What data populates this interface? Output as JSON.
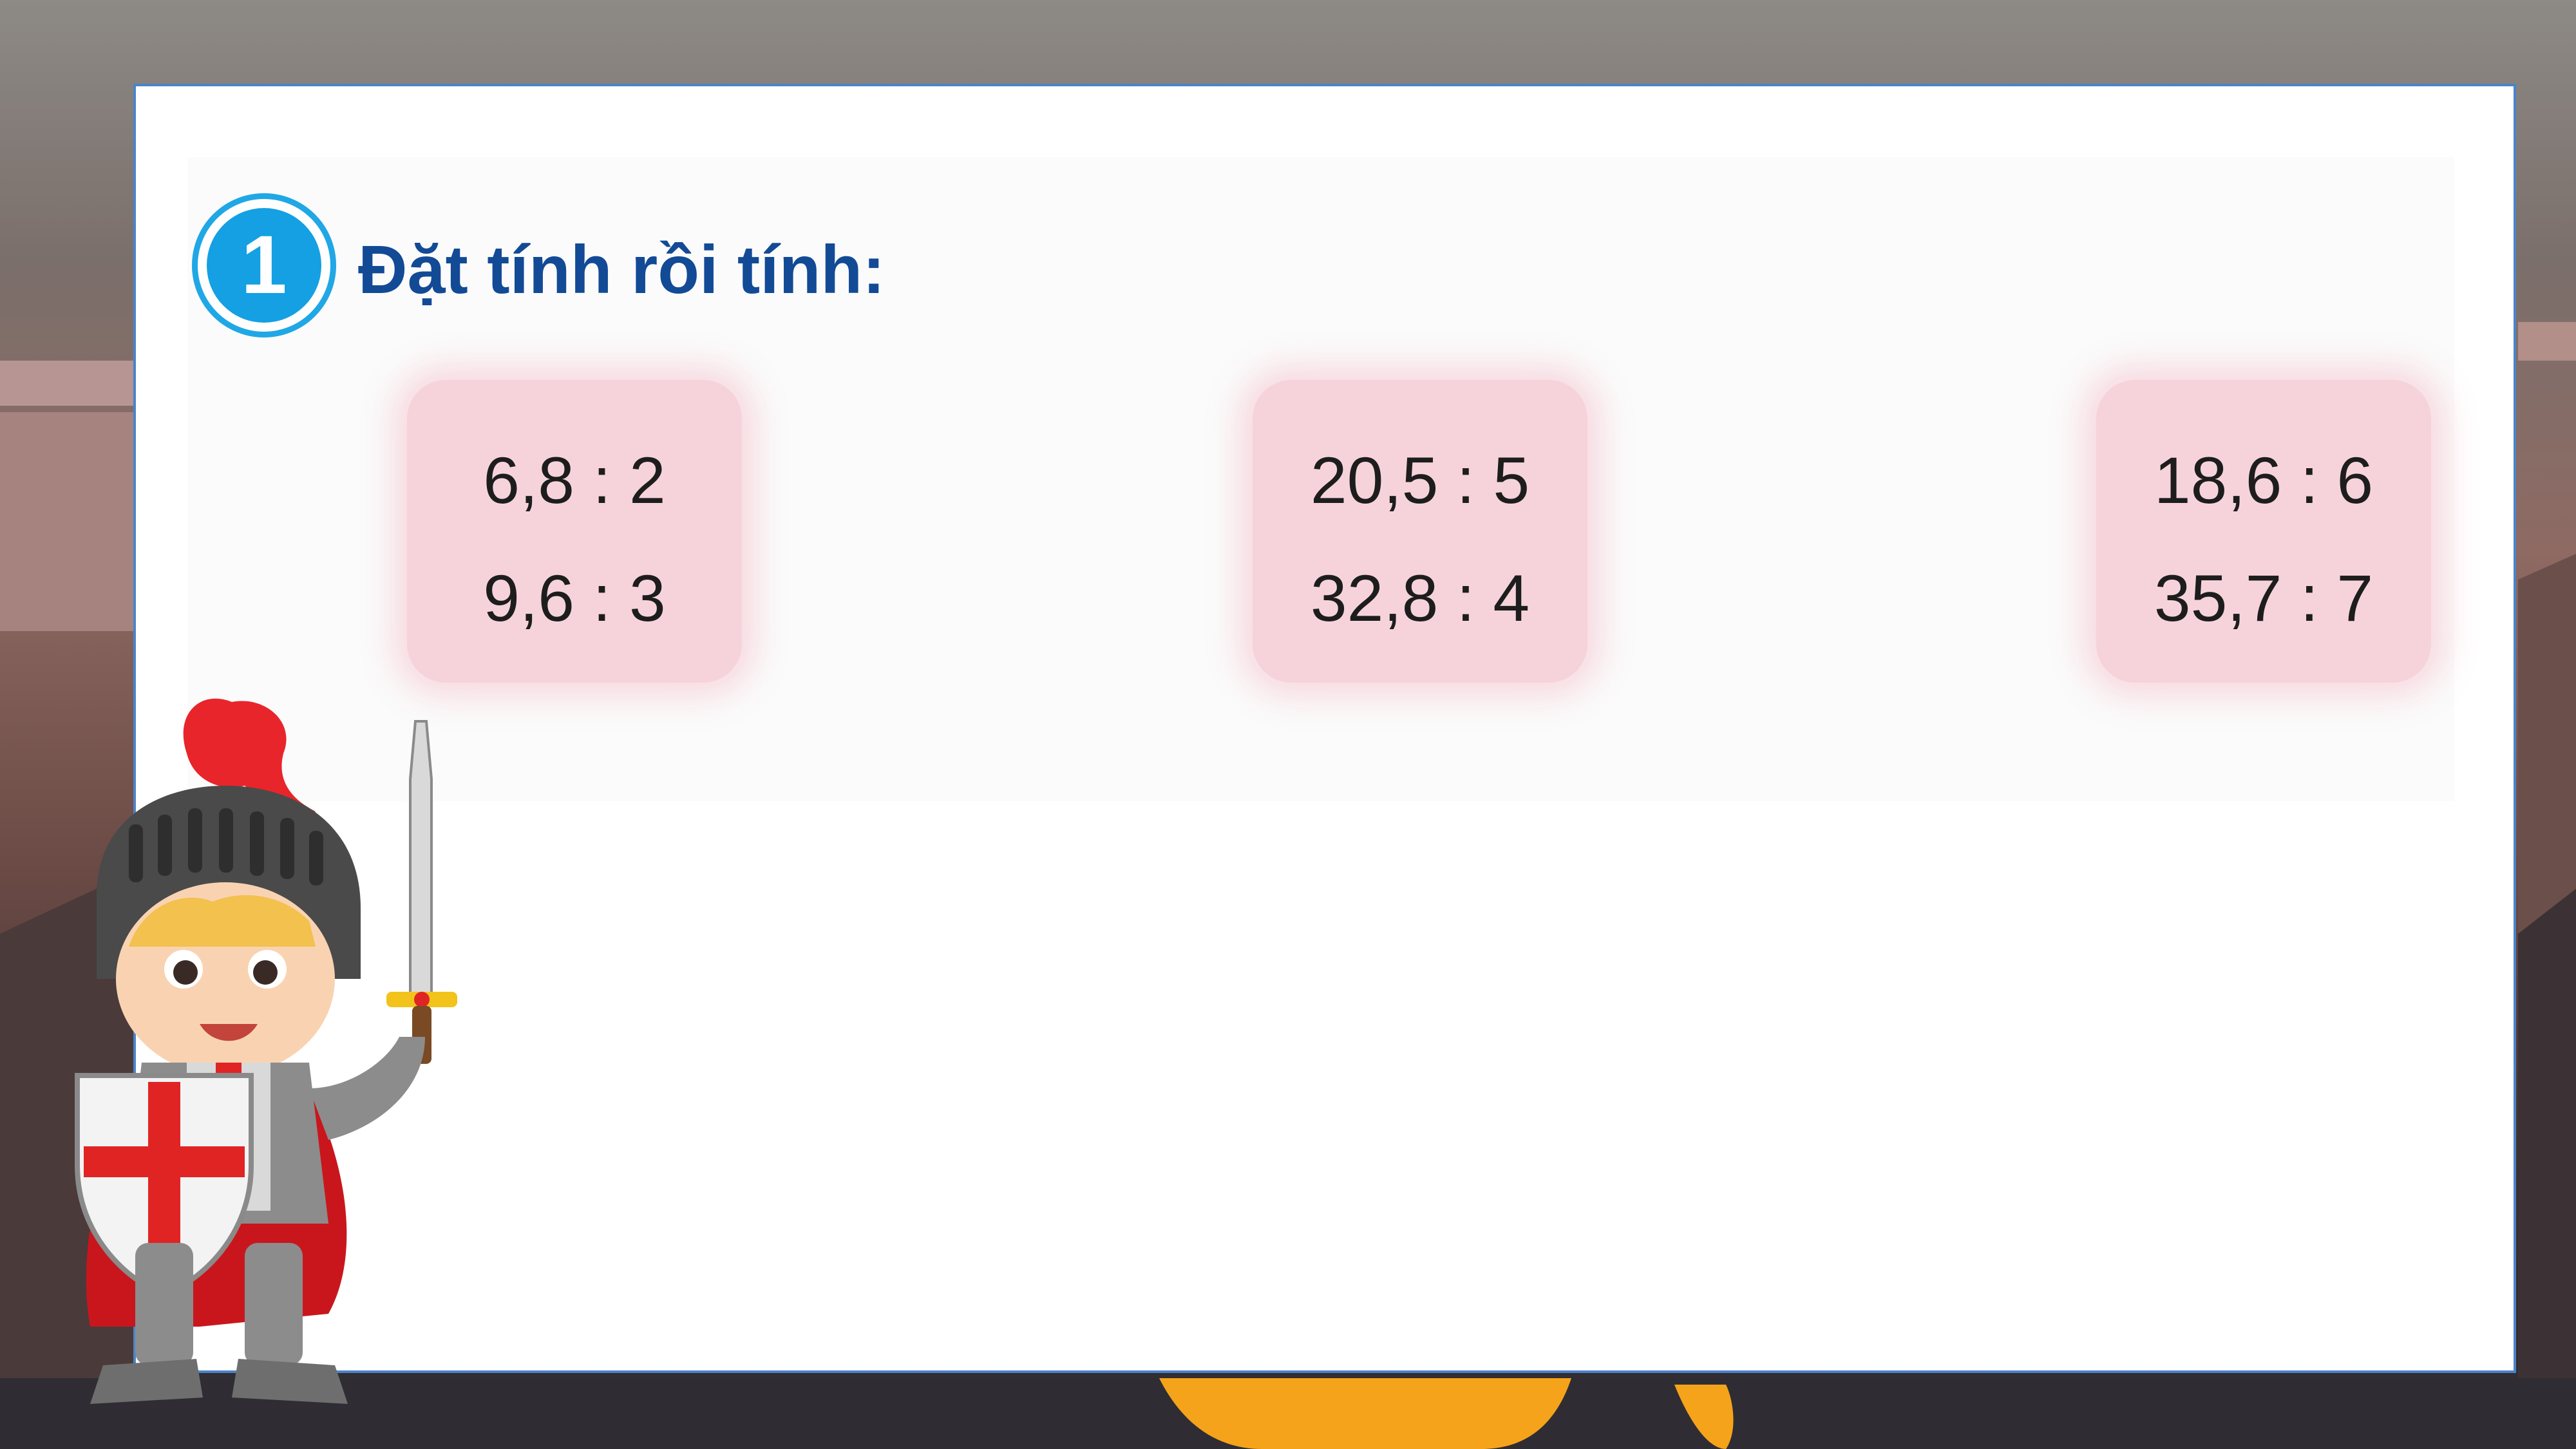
{
  "exercise": {
    "number": "1",
    "title": "Đặt tính rồi tính:"
  },
  "problems": [
    {
      "line1": "6,8 : 2",
      "line2": "9,6 : 3"
    },
    {
      "line1": "20,5 : 5",
      "line2": "32,8 : 4"
    },
    {
      "line1": "18,6 : 6",
      "line2": "35,7 : 7"
    }
  ],
  "colors": {
    "title": "#124a96",
    "badge": "#14a0e3",
    "card": "#f6d3db",
    "board_border": "#4a84c9"
  }
}
